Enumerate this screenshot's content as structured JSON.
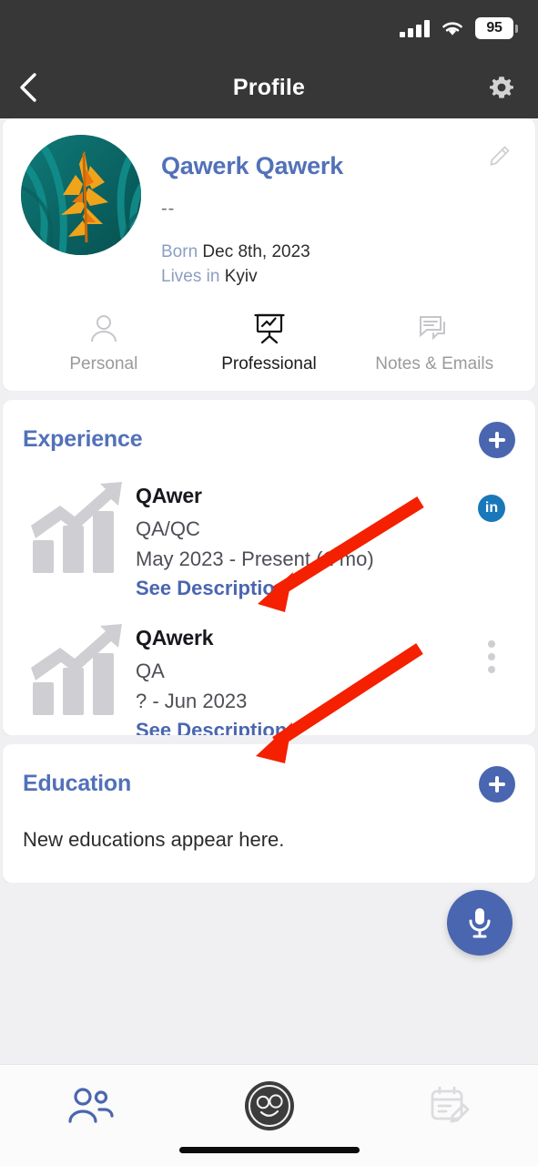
{
  "status_bar": {
    "battery_percent": "95",
    "signal_icon": "cellular-signal-icon",
    "wifi_icon": "wifi-icon",
    "battery_icon": "battery-icon"
  },
  "header": {
    "title": "Profile",
    "back_icon": "chevron-left-icon",
    "settings_icon": "gear-icon",
    "background_color": "#373737"
  },
  "profile": {
    "name": "Qawerk Qawerk",
    "headline": "--",
    "born_label": "Born",
    "born_value": "Dec 8th, 2023",
    "lives_label": "Lives in",
    "lives_value": "Kyiv",
    "edit_icon": "pencil-icon",
    "avatar_icon": "avatar-photo",
    "name_color": "#5271b8"
  },
  "tabs": [
    {
      "label": "Personal",
      "icon": "person-icon",
      "active": false
    },
    {
      "label": "Professional",
      "icon": "presentation-chart-icon",
      "active": true
    },
    {
      "label": "Notes & Emails",
      "icon": "speech-bubbles-icon",
      "active": false
    }
  ],
  "experience": {
    "title": "Experience",
    "add_icon": "plus-icon",
    "items": [
      {
        "company": "QAwer",
        "role": "QA/QC",
        "dates": "May 2023 - Present (1 mo)",
        "link": "See Description",
        "icon": "growth-chart-icon",
        "action_icon": "linkedin-icon",
        "action_label": "in"
      },
      {
        "company": "QAwerk",
        "role": "QA",
        "dates": "? - Jun 2023",
        "link": "See Description",
        "icon": "growth-chart-icon",
        "action_icon": "kebab-menu-icon",
        "action_label": ""
      }
    ]
  },
  "education": {
    "title": "Education",
    "add_icon": "plus-icon",
    "empty_text": "New educations appear here."
  },
  "fab": {
    "icon": "microphone-icon",
    "color": "#4a66b0"
  },
  "bottom_nav": [
    {
      "icon": "contacts-people-icon",
      "active": true
    },
    {
      "icon": "app-logo-face-icon",
      "active": false
    },
    {
      "icon": "calendar-edit-icon",
      "active": false
    }
  ],
  "annotations": {
    "arrow_color": "#f42000",
    "arrows": [
      {
        "name": "arrow-to-see-description-1"
      },
      {
        "name": "arrow-to-see-description-2"
      }
    ]
  }
}
